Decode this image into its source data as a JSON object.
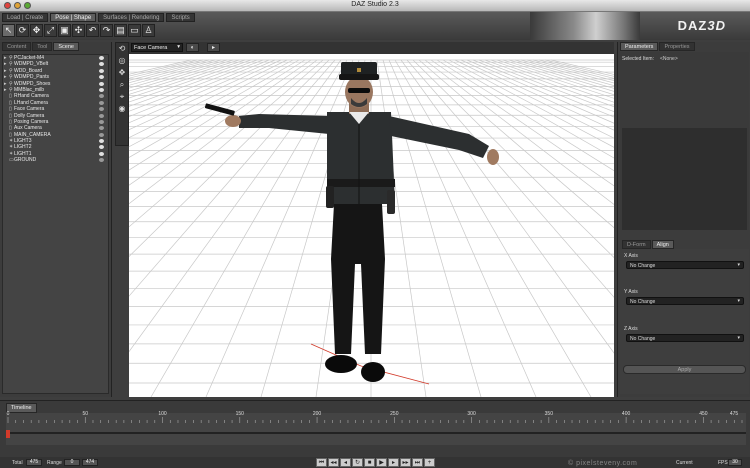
{
  "window": {
    "title": "DAZ Studio 2.3"
  },
  "header": {
    "logo_primary": "DAZ",
    "logo_secondary": "3D",
    "mode_tabs": [
      {
        "label": "Load | Create",
        "active": false
      },
      {
        "label": "Pose | Shape",
        "active": true
      },
      {
        "label": "Surfaces | Rendering",
        "active": false
      },
      {
        "label": "Scripts",
        "active": false
      }
    ],
    "tool_icons": [
      "pointer-icon",
      "rotate-icon",
      "translate-icon",
      "scale-icon",
      "node-scale-icon",
      "universal-tool-icon",
      "undo-icon",
      "redo-icon",
      "render-icon",
      "camera-icon",
      "figure-icon"
    ]
  },
  "left_panel": {
    "tabs": [
      {
        "label": "Content",
        "active": false
      },
      {
        "label": "Tool",
        "active": false
      },
      {
        "label": "Scene",
        "active": true
      }
    ],
    "scene_items": [
      {
        "label": "PCJacket-M4",
        "arrow": "▸",
        "kind": "figure",
        "visible": true
      },
      {
        "label": "WDMPD_VBelt",
        "arrow": "▸",
        "kind": "figure",
        "visible": true
      },
      {
        "label": "WDD_Board",
        "arrow": "▸",
        "kind": "figure",
        "visible": true
      },
      {
        "label": "WDMPD_Pants",
        "arrow": "▸",
        "kind": "figure",
        "visible": true
      },
      {
        "label": "WDMPD_Shoes",
        "arrow": "▸",
        "kind": "figure",
        "visible": true
      },
      {
        "label": "MMBlac_milb",
        "arrow": "▸",
        "kind": "figure",
        "visible": true
      },
      {
        "label": "RHand Camera",
        "arrow": "",
        "kind": "camera",
        "visible": false
      },
      {
        "label": "LHand Camera",
        "arrow": "",
        "kind": "camera",
        "visible": false
      },
      {
        "label": "Face Camera",
        "arrow": "",
        "kind": "camera",
        "visible": false
      },
      {
        "label": "Dolly Camera",
        "arrow": "",
        "kind": "camera",
        "visible": false
      },
      {
        "label": "Posing Camera",
        "arrow": "",
        "kind": "camera",
        "visible": false
      },
      {
        "label": "Aux Camera",
        "arrow": "",
        "kind": "camera",
        "visible": false
      },
      {
        "label": "MAIN_CAMERA",
        "arrow": "",
        "kind": "camera",
        "visible": false
      },
      {
        "label": "LIGHT3",
        "arrow": "",
        "kind": "light",
        "visible": true
      },
      {
        "label": "LIGHT2",
        "arrow": "",
        "kind": "light",
        "visible": true
      },
      {
        "label": "LIGHT1",
        "arrow": "",
        "kind": "light",
        "visible": true
      },
      {
        "label": "GROUND",
        "arrow": "",
        "kind": "ground",
        "visible": false
      }
    ]
  },
  "viewport": {
    "camera": "Face Camera",
    "side_tools": [
      "rotate-view-icon",
      "orbit-icon",
      "pan-icon",
      "zoom-icon",
      "frame-icon",
      "aim-icon"
    ]
  },
  "right_panel": {
    "tabs": [
      {
        "label": "Parameters",
        "active": true
      },
      {
        "label": "Properties",
        "active": false
      }
    ],
    "selected_item_label": "Selected Item:",
    "selected_item_value": "<None>",
    "adjust_tabs": [
      {
        "label": "D-Form",
        "active": false
      },
      {
        "label": "Align",
        "active": true
      }
    ],
    "axes": [
      {
        "label": "X Axis",
        "value": "No Change"
      },
      {
        "label": "Y Axis",
        "value": "No Change"
      },
      {
        "label": "Z Axis",
        "value": "No Change"
      }
    ],
    "apply_label": "Apply"
  },
  "timeline": {
    "tab": "Timeline",
    "ticks": [
      "0",
      "50",
      "100",
      "150",
      "200",
      "250",
      "300",
      "350",
      "400",
      "450"
    ],
    "end_tick": "475",
    "total_label": "Total",
    "total_value": "475",
    "range_label": "Range",
    "range_start": "0",
    "range_end": "474",
    "current_label": "Current",
    "fps_label": "FPS",
    "fps_value": "30"
  },
  "watermark": "© pixelsteveny.com",
  "colors": {
    "accent_red": "#d23a2a",
    "panel_bg": "#3c3c3c",
    "viewport_bg": "#ffffff"
  }
}
